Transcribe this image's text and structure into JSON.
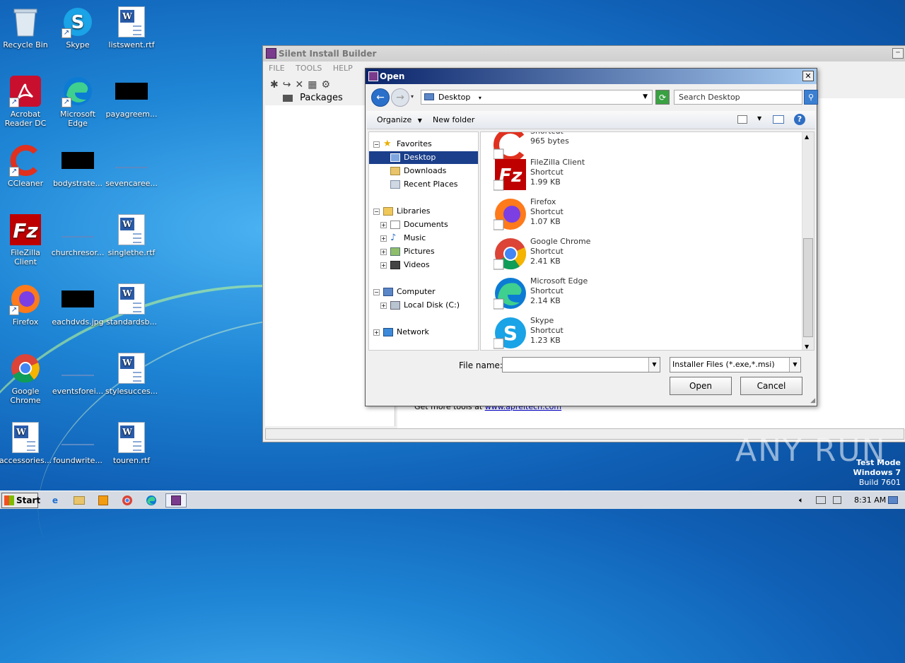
{
  "desktop": {
    "icons": [
      {
        "label": "Recycle Bin"
      },
      {
        "label": "Skype"
      },
      {
        "label": "listswent.rtf"
      },
      {
        "label": "Acrobat Reader DC"
      },
      {
        "label": "Microsoft Edge"
      },
      {
        "label": "payagreem..."
      },
      {
        "label": "CCleaner"
      },
      {
        "label": "bodystrate..."
      },
      {
        "label": "sevencaree..."
      },
      {
        "label": "FileZilla Client"
      },
      {
        "label": "churchresor..."
      },
      {
        "label": "singlethe.rtf"
      },
      {
        "label": "Firefox"
      },
      {
        "label": "eachdvds.jpg"
      },
      {
        "label": "standardsb..."
      },
      {
        "label": "Google Chrome"
      },
      {
        "label": "eventsforei..."
      },
      {
        "label": "stylesucces..."
      },
      {
        "label": "accessories..."
      },
      {
        "label": "foundwrite..."
      },
      {
        "label": "touren.rtf"
      }
    ]
  },
  "app": {
    "title": "Silent Install Builder",
    "menu": [
      "FILE",
      "TOOLS",
      "HELP"
    ],
    "packages_label": "Packages",
    "footer_text": "Get more tools at ",
    "footer_link": "www.apreltech.com"
  },
  "dialog": {
    "title": "Open",
    "path": "Desktop",
    "search_placeholder": "Search Desktop",
    "organize": "Organize",
    "new_folder": "New folder",
    "nav": {
      "favorites": "Favorites",
      "desktop": "Desktop",
      "downloads": "Downloads",
      "recent": "Recent Places",
      "libraries": "Libraries",
      "documents": "Documents",
      "music": "Music",
      "pictures": "Pictures",
      "videos": "Videos",
      "computer": "Computer",
      "local_disk": "Local Disk (C:)",
      "network": "Network"
    },
    "files": [
      {
        "name": "",
        "type": "Shortcut",
        "size": "965 bytes"
      },
      {
        "name": "FileZilla Client",
        "type": "Shortcut",
        "size": "1.99 KB"
      },
      {
        "name": "Firefox",
        "type": "Shortcut",
        "size": "1.07 KB"
      },
      {
        "name": "Google Chrome",
        "type": "Shortcut",
        "size": "2.41 KB"
      },
      {
        "name": "Microsoft Edge",
        "type": "Shortcut",
        "size": "2.14 KB"
      },
      {
        "name": "Skype",
        "type": "Shortcut",
        "size": "1.23 KB"
      }
    ],
    "file_name_label": "File name:",
    "file_name_value": "",
    "filter": "Installer Files (*.exe,*.msi)",
    "open": "Open",
    "cancel": "Cancel"
  },
  "taskbar": {
    "start": "Start",
    "clock": "8:31 AM"
  },
  "watermark": "ANY RUN",
  "test_mode": {
    "line1": "Test Mode",
    "line2": "Windows 7",
    "line3": "Build 7601"
  },
  "colors": {
    "dialog_title_start": "#0a246a",
    "selection": "#1b3f8b",
    "desktop_blue": "#1f86d6"
  }
}
